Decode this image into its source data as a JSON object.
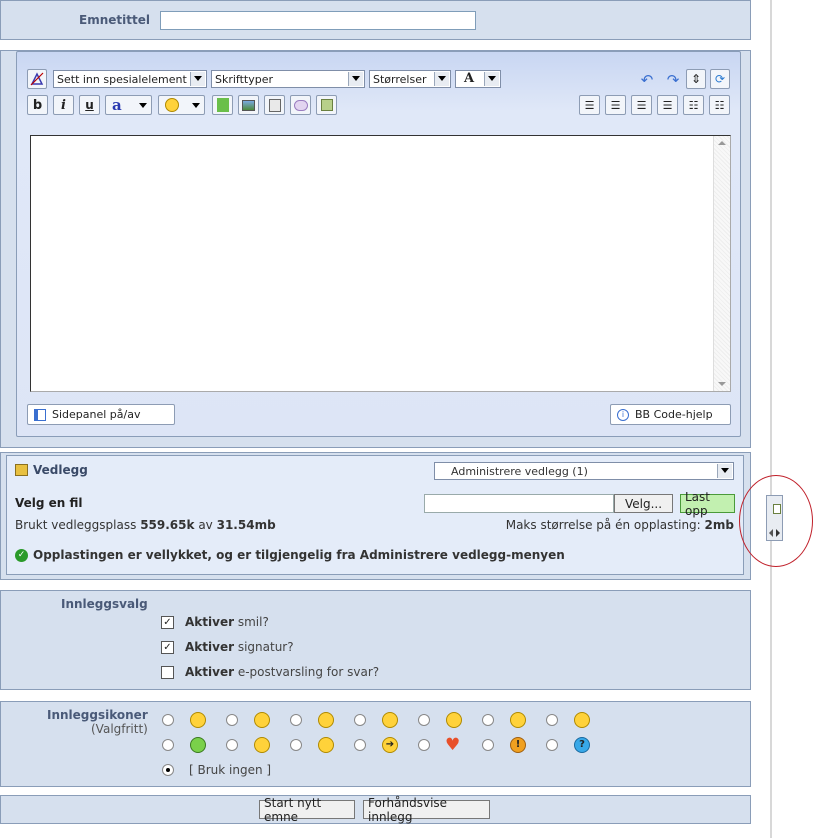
{
  "subject": {
    "label": "Emnetittel",
    "value": ""
  },
  "toolbar": {
    "special_select": "Sett inn spesialelement",
    "font_select": "Skrifttyper",
    "size_select": "Størrelser",
    "color_label": "A",
    "bold": "b",
    "italic": "i",
    "underline": "u",
    "typo": "a"
  },
  "editor": {
    "sidebar_toggle": "Sidepanel på/av",
    "bbcode_help": "BB Code-hjelp"
  },
  "attachments": {
    "title": "Vedlegg",
    "manage_select": "Administrere vedlegg (1)",
    "choose_label": "Velg en fil",
    "browse_button": "Velg...",
    "upload_button": "Last opp",
    "used_prefix": "Brukt vedleggsplass",
    "used_value": "559.65k",
    "used_of": "av",
    "used_total": "31.54mb",
    "max_prefix": "Maks størrelse på én opplasting:",
    "max_value": "2mb",
    "success": "Opplastingen er vellykket, og er tilgjengelig fra Administrere vedlegg-menyen"
  },
  "options": {
    "label": "Innleggsvalg",
    "items": [
      {
        "strong": "Aktiver",
        "text": "smil?",
        "checked": true
      },
      {
        "strong": "Aktiver",
        "text": "signatur?",
        "checked": true
      },
      {
        "strong": "Aktiver",
        "text": "e-postvarsling for svar?",
        "checked": false
      }
    ]
  },
  "icons": {
    "label": "Innleggsikoner",
    "sublabel": "(Valgfritt)",
    "none_label": "[ Bruk ingen ]"
  },
  "actions": {
    "submit": "Start nytt emne",
    "preview": "Forhåndsvise innlegg"
  }
}
